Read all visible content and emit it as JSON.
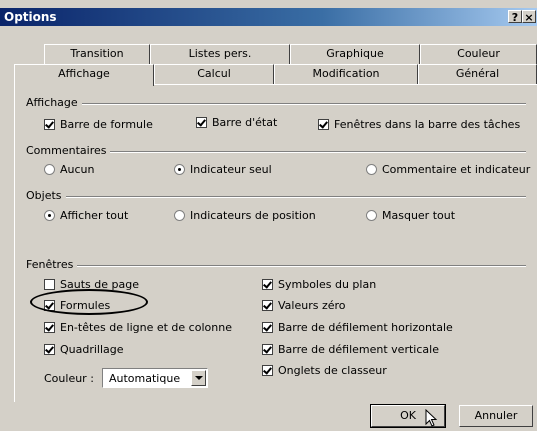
{
  "window": {
    "title": "Options",
    "help_label": "?",
    "close_label": "×"
  },
  "tabs": {
    "row1": [
      "Transition",
      "Listes pers.",
      "Graphique",
      "Couleur"
    ],
    "row2": [
      "Affichage",
      "Calcul",
      "Modification",
      "Général"
    ],
    "active": "Affichage"
  },
  "affichage": {
    "label": "Affichage",
    "options": [
      {
        "label": "Barre de formule",
        "checked": true
      },
      {
        "label": "Barre d'état",
        "checked": true
      },
      {
        "label": "Fenêtres dans la barre des tâches",
        "checked": true
      }
    ]
  },
  "commentaires": {
    "label": "Commentaires",
    "options": [
      {
        "label": "Aucun",
        "selected": false
      },
      {
        "label": "Indicateur seul",
        "selected": true
      },
      {
        "label": "Commentaire et indicateur",
        "selected": false
      }
    ]
  },
  "objets": {
    "label": "Objets",
    "options": [
      {
        "label": "Afficher tout",
        "selected": true
      },
      {
        "label": "Indicateurs de position",
        "selected": false
      },
      {
        "label": "Masquer tout",
        "selected": false
      }
    ]
  },
  "fenetres": {
    "label": "Fenêtres",
    "left": [
      {
        "label": "Sauts de page",
        "checked": false
      },
      {
        "label": "Formules",
        "checked": true
      },
      {
        "label": "En-têtes de ligne et de colonne",
        "checked": true
      },
      {
        "label": "Quadrillage",
        "checked": true
      }
    ],
    "right": [
      {
        "label": "Symboles du plan",
        "checked": true
      },
      {
        "label": "Valeurs zéro",
        "checked": true
      },
      {
        "label": "Barre de défilement horizontale",
        "checked": true
      },
      {
        "label": "Barre de défilement verticale",
        "checked": true
      },
      {
        "label": "Onglets de classeur",
        "checked": true
      }
    ],
    "color_label": "Couleur :",
    "color_value": "Automatique"
  },
  "buttons": {
    "ok": "OK",
    "cancel": "Annuler"
  }
}
